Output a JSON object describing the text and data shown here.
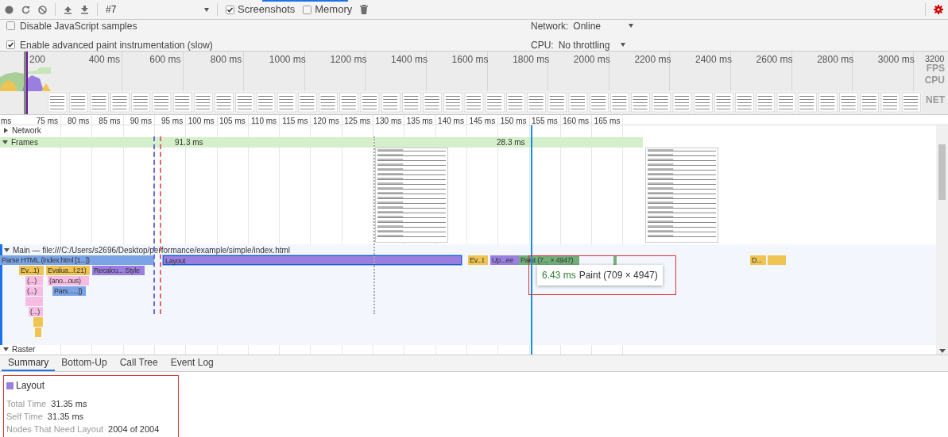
{
  "toolbar": {
    "recording": "#7",
    "options": [
      {
        "label": "Screenshots",
        "checked": true
      },
      {
        "label": "Memory",
        "checked": false
      }
    ]
  },
  "settings": {
    "checkboxes": [
      {
        "label": "Disable JavaScript samples",
        "checked": false
      },
      {
        "label": "Enable advanced paint instrumentation (slow)",
        "checked": true
      }
    ],
    "throttles": [
      {
        "label": "Network:",
        "value": "Online"
      },
      {
        "label": "CPU:",
        "value": "No throttling"
      }
    ]
  },
  "overview": {
    "ticks": [
      "200",
      "400 ms",
      "600 ms",
      "800 ms",
      "1000 ms",
      "1200 ms",
      "1400 ms",
      "1600 ms",
      "1800 ms",
      "2000 ms",
      "2200 ms",
      "2400 ms",
      "2600 ms",
      "2800 ms",
      "3000 ms",
      "3200"
    ],
    "track_labels": [
      "FPS",
      "CPU",
      "NET"
    ]
  },
  "ruler": [
    "ms",
    "75 ms",
    "80 ms",
    "85 ms",
    "90 ms",
    "95 ms",
    "100 ms",
    "105 ms",
    "110 ms",
    "115 ms",
    "120 ms",
    "125 ms",
    "130 ms",
    "135 ms",
    "140 ms",
    "145 ms",
    "150 ms",
    "155 ms",
    "160 ms",
    "165 ms"
  ],
  "tracks": [
    {
      "kind": "network",
      "label": "Network",
      "expanded": false
    },
    {
      "kind": "frames",
      "label": "Frames",
      "expanded": true,
      "frames": [
        "91.3 ms",
        "28.3 ms"
      ]
    },
    {
      "kind": "main",
      "label": "Main — file:///C:/Users/s2696/Desktop/performance/example/simple/index.html",
      "expanded": true,
      "events": [
        {
          "label": "Parse HTML (index.html [1...])",
          "kind": "loading",
          "selected": false
        },
        {
          "label": "Layout",
          "kind": "rendering",
          "selected": true
        },
        {
          "label": "Ev...t",
          "kind": "scripting",
          "selected": false
        },
        {
          "label": "Up...ee",
          "kind": "rendering",
          "selected": false
        },
        {
          "label": "Paint (7... × 4947)",
          "kind": "painting",
          "selected": false
        },
        {
          "kind": "painting",
          "selected": false
        },
        {
          "label": "D...",
          "kind": "scripting",
          "selected": false
        },
        {
          "kind": "scripting",
          "selected": false
        },
        {
          "label": "Ev...1)",
          "kind": "scripting",
          "selected": false
        },
        {
          "label": "Evalua...l:21)",
          "kind": "scripting",
          "selected": false
        },
        {
          "label": "Recalcu... Style",
          "kind": "rendering",
          "selected": false
        },
        {
          "label": "(...)",
          "kind": "function",
          "selected": false
        },
        {
          "label": "(ano...ous)",
          "kind": "function",
          "selected": false
        },
        {
          "label": "(...)",
          "kind": "function",
          "selected": false
        },
        {
          "label": "Pars......])",
          "kind": "loading",
          "selected": false
        },
        {
          "kind": "function",
          "selected": false
        },
        {
          "label": "(...)",
          "kind": "function",
          "selected": false
        },
        {
          "kind": "scripting",
          "selected": false
        },
        {
          "kind": "scripting",
          "selected": false
        }
      ],
      "tooltip": {
        "duration": "6.43 ms",
        "label": "Paint (709 × 4947)"
      }
    },
    {
      "kind": "raster",
      "label": "Raster",
      "expanded": true
    }
  ],
  "tabs": [
    {
      "label": "Summary",
      "selected": true
    },
    {
      "label": "Bottom-Up",
      "selected": false
    },
    {
      "label": "Call Tree",
      "selected": false
    },
    {
      "label": "Event Log",
      "selected": false
    }
  ],
  "summary": {
    "title": "Layout",
    "kind": "rendering",
    "rows": [
      {
        "label": "Total Time",
        "value": "31.35 ms"
      },
      {
        "label": "Self Time",
        "value": "31.35 ms"
      },
      {
        "label": "Nodes That Need Layout",
        "value": "2004 of 2004"
      }
    ]
  }
}
